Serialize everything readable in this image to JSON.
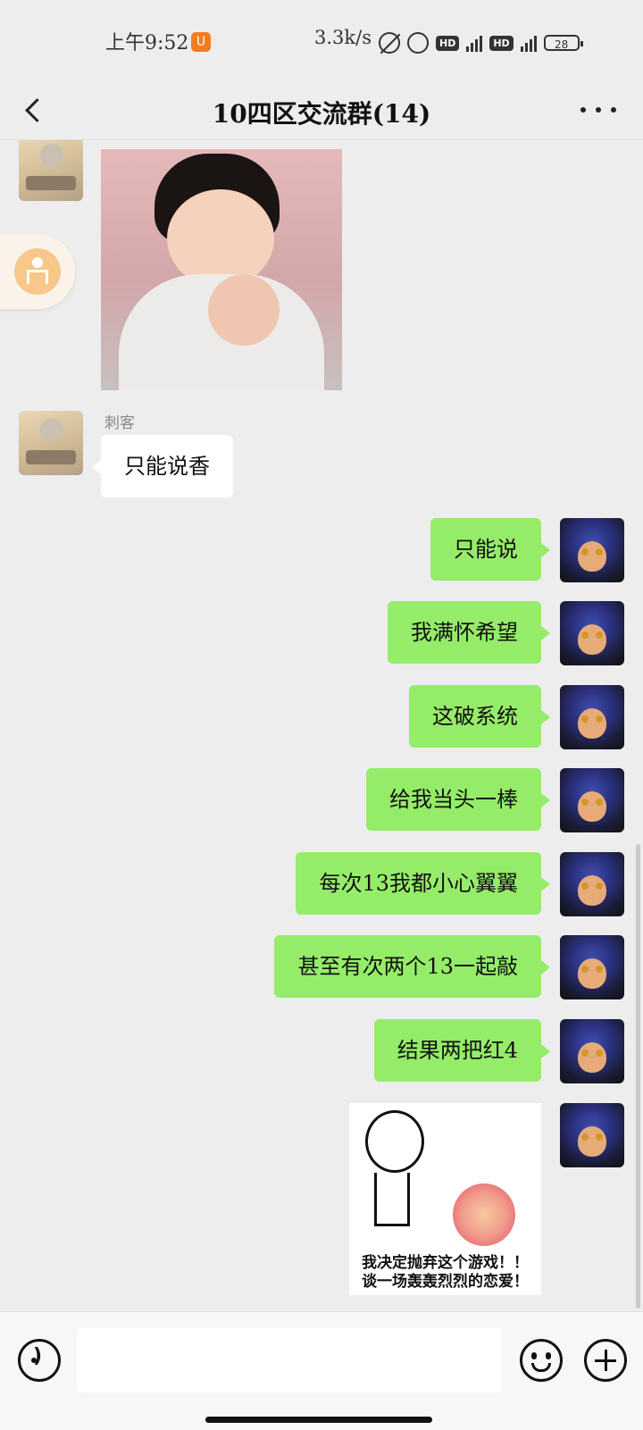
{
  "status_bar": {
    "time": "上午9:52",
    "app_icon": "uc-browser-icon",
    "network_speed": "3.3k/s",
    "battery": "28"
  },
  "header": {
    "title": "10四区交流群(14)",
    "back_icon": "chevron-left-icon",
    "more_icon": "more-dots-icon"
  },
  "messages": [
    {
      "direction": "in",
      "type": "image",
      "sender": "刺客",
      "content": "child-clapping-photo"
    },
    {
      "direction": "in",
      "type": "text",
      "sender": "刺客",
      "text": "只能说香"
    },
    {
      "direction": "out",
      "type": "text",
      "text": "只能说"
    },
    {
      "direction": "out",
      "type": "text",
      "text": "我满怀希望"
    },
    {
      "direction": "out",
      "type": "text",
      "text": "这破系统"
    },
    {
      "direction": "out",
      "type": "text",
      "text": "给我当头一棒"
    },
    {
      "direction": "out",
      "type": "text",
      "text": "每次13我都小心翼翼"
    },
    {
      "direction": "out",
      "type": "text",
      "text": "甚至有次两个13一起敲"
    },
    {
      "direction": "out",
      "type": "text",
      "text": "结果两把红4"
    },
    {
      "direction": "out",
      "type": "image",
      "caption_line1": "我决定抛弃这个游戏！！",
      "caption_line2": "谈一场轰轰烈烈的恋爱！"
    }
  ],
  "input_bar": {
    "text_value": "",
    "voice_icon": "voice-icon",
    "emoji_icon": "emoji-icon",
    "plus_icon": "plus-icon"
  },
  "colors": {
    "background": "#ededed",
    "outgoing_bubble": "#95ec69",
    "incoming_bubble": "#ffffff",
    "accent_float": "#f8c78a"
  }
}
